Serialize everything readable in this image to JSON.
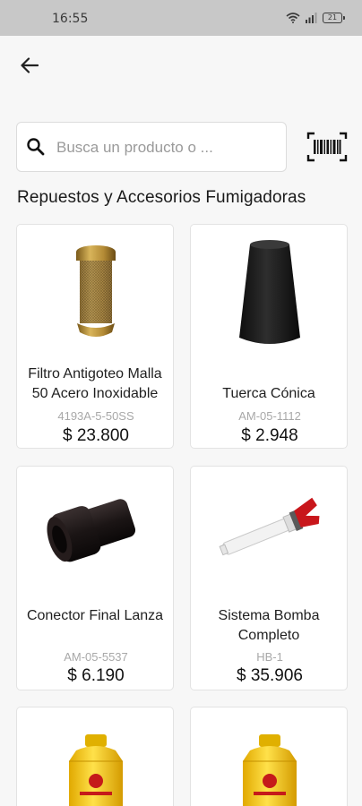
{
  "status_bar": {
    "time": "16:55",
    "battery": "21"
  },
  "search": {
    "placeholder": "Busca un producto o ..."
  },
  "section": {
    "title": "Repuestos y Accesorios Fumigadoras"
  },
  "products": [
    {
      "name": "Filtro Antigoteo Malla 50 Acero Inoxidable",
      "sku": "4193A-5-50SS",
      "price": "$ 23.800",
      "icon": "brass-mesh-filter-image"
    },
    {
      "name": "Tuerca Cónica",
      "sku": "AM-05-1112",
      "price": "$ 2.948",
      "icon": "black-conical-nut-image"
    },
    {
      "name": "Conector Final Lanza",
      "sku": "AM-05-5537",
      "price": "$ 6.190",
      "icon": "lance-connector-image"
    },
    {
      "name": "Sistema Bomba Completo",
      "sku": "HB-1",
      "price": "$ 35.906",
      "icon": "pump-system-image"
    },
    {
      "name": "",
      "sku": "",
      "price": "",
      "icon": "yellow-sprayer-tank-image"
    },
    {
      "name": "",
      "sku": "",
      "price": "",
      "icon": "yellow-sprayer-tank-image"
    }
  ],
  "colors": {
    "background": "#f7f7f7",
    "status_bar": "#c8c8c8",
    "card": "#ffffff",
    "sku_text": "#a8a8a8"
  }
}
